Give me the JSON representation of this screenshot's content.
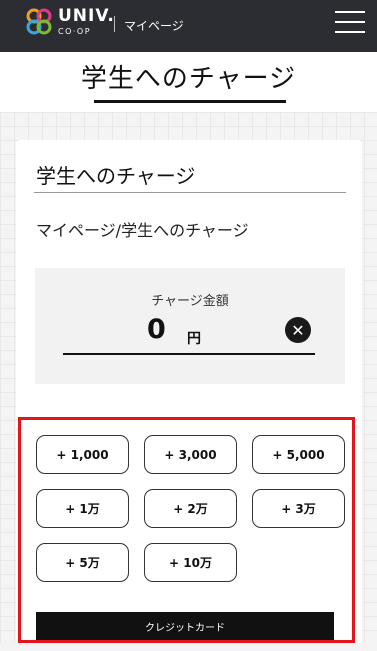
{
  "header": {
    "brand_top": "UNIV.",
    "brand_bottom": "CO·OP",
    "mypage_label": "マイページ",
    "menu_icon": "hamburger-menu-icon",
    "logo_colors": [
      "#f0a01e",
      "#e03a8c",
      "#3aa8d8",
      "#7dbb35"
    ]
  },
  "page": {
    "title": "学生へのチャージ"
  },
  "card": {
    "title": "学生へのチャージ",
    "breadcrumb": "マイページ/学生へのチャージ"
  },
  "amount": {
    "label": "チャージ金額",
    "value": "0",
    "unit": "円",
    "clear_icon": "close-circle-icon"
  },
  "preset_buttons": [
    "+ 1,000",
    "+ 3,000",
    "+ 5,000",
    "+ 1万",
    "+ 2万",
    "+ 3万",
    "+ 5万",
    "+ 10万"
  ],
  "payment": {
    "credit_card_label": "クレジットカード"
  },
  "colors": {
    "header_bg": "#2b2d33",
    "highlight": "#e3151a"
  }
}
